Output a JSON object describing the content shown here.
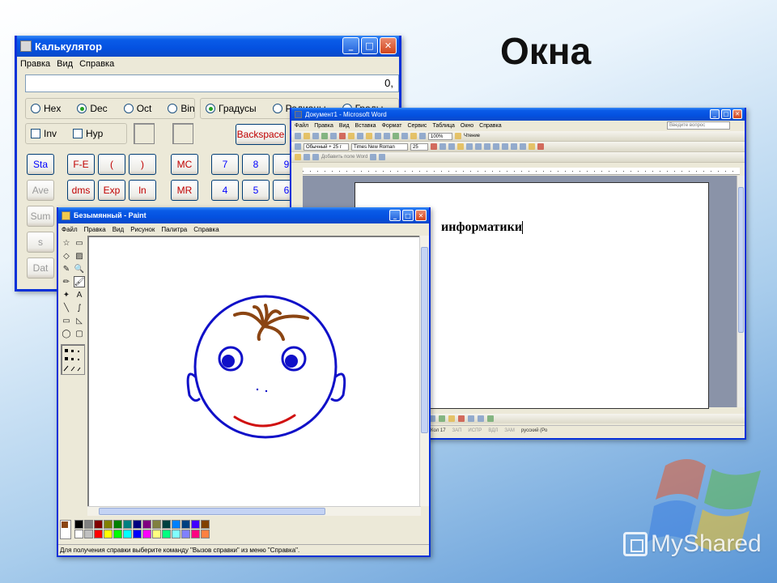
{
  "slide": {
    "title": "Окна",
    "watermark": "MyShared",
    "logo_colors": [
      "#e35a2d",
      "#5cb84a",
      "#3a7ee0",
      "#f7c21b"
    ]
  },
  "calculator": {
    "title": "Калькулятор",
    "menu": [
      "Правка",
      "Вид",
      "Справка"
    ],
    "display_value": "0,",
    "base_options": [
      {
        "label": "Hex",
        "selected": false
      },
      {
        "label": "Dec",
        "selected": true
      },
      {
        "label": "Oct",
        "selected": false
      },
      {
        "label": "Bin",
        "selected": false
      }
    ],
    "angle_options": [
      {
        "label": "Градусы",
        "selected": true
      },
      {
        "label": "Радианы",
        "selected": false
      },
      {
        "label": "Грады",
        "selected": false
      }
    ],
    "inv_label": "Inv",
    "hyp_label": "Hyp",
    "backspace_label": "Backspace",
    "keys": {
      "sta": "Sta",
      "ave": "Ave",
      "sum": "Sum",
      "s": "s",
      "dat": "Dat",
      "fe": "F-E",
      "open": "(",
      "close": ")",
      "dms": "dms",
      "exp": "Exp",
      "ln": "ln",
      "mc": "MC",
      "mr": "MR",
      "d7": "7",
      "d8": "8",
      "d9": "9",
      "d4": "4",
      "d5": "5",
      "d6": "6"
    }
  },
  "word": {
    "title": "Документ1 - Microsoft Word",
    "menu": [
      "Файл",
      "Правка",
      "Вид",
      "Вставка",
      "Формат",
      "Сервис",
      "Таблица",
      "Окно",
      "Справка"
    ],
    "search_placeholder": "Введите вопрос",
    "zoom": "100%",
    "reading_label": "Чтение",
    "style_value": "Обычный + 25 г",
    "font_value": "Times New Roman",
    "size_value": "25",
    "add_field_label": "Добавить поле Word",
    "document_text": "информатики",
    "status": {
      "col": "Кол 17",
      "zap": "ЗАП",
      "ispr": "ИСПР",
      "vdl": "ВДЛ",
      "zam": "ЗАМ",
      "lang": "русский (Ро"
    }
  },
  "paint": {
    "title": "Безымянный - Paint",
    "menu": [
      "Файл",
      "Правка",
      "Вид",
      "Рисунок",
      "Палитра",
      "Справка"
    ],
    "status_text": "Для получения справки выберите команду \"Вызов справки\" из меню \"Справка\".",
    "tool_glyphs": [
      "☆",
      "▭",
      "◇",
      "▨",
      "✎",
      "🔍",
      "✏",
      "🖌",
      "✦",
      "A",
      "╲",
      "∫",
      "▭",
      "◺",
      "◯",
      "▢"
    ],
    "palette": [
      "#000000",
      "#808080",
      "#800000",
      "#808000",
      "#008000",
      "#008080",
      "#000080",
      "#800080",
      "#808040",
      "#004040",
      "#0080ff",
      "#004080",
      "#4000ff",
      "#804000",
      "#ffffff",
      "#c0c0c0",
      "#ff0000",
      "#ffff00",
      "#00ff00",
      "#00ffff",
      "#0000ff",
      "#ff00ff",
      "#ffff80",
      "#00ff80",
      "#80ffff",
      "#8080ff",
      "#ff0080",
      "#ff8040"
    ],
    "drawing_colors": {
      "face": "#1010c8",
      "hair": "#8b4513",
      "mouth": "#d01010"
    }
  }
}
